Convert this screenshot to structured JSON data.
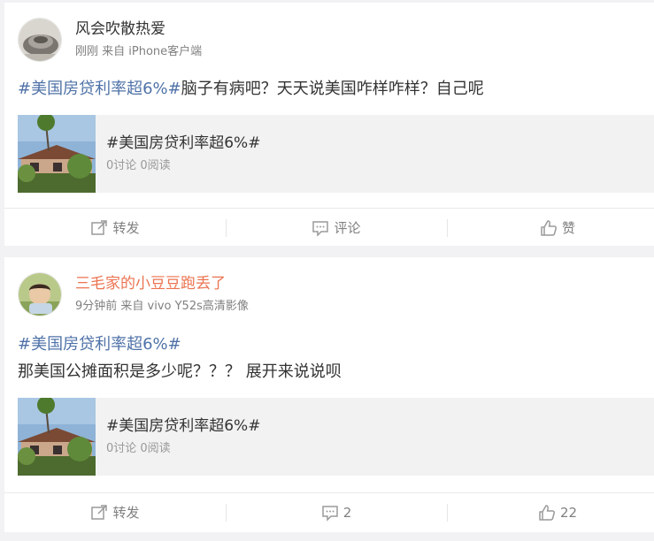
{
  "posts": [
    {
      "username": "风会吹散热爱",
      "meta": "刚刚 来自 iPhone客户端",
      "hashtag": "#美国房贷利率超6%#",
      "text": "脑子有病吧？天天说美国咋样咋样？自己呢",
      "topic": {
        "title": "#美国房贷利率超6%#",
        "stats": "0讨论 0阅读"
      },
      "actions": {
        "repost": "转发",
        "comment": "评论",
        "like": "赞"
      }
    },
    {
      "username": "三毛家的小豆豆跑丢了",
      "meta": "9分钟前 来自 vivo Y52s高清影像",
      "hashtag": "#美国房贷利率超6%#",
      "text": "那美国公摊面积是多少呢？？？ 展开来说说呗",
      "topic": {
        "title": "#美国房贷利率超6%#",
        "stats": "0讨论 0阅读"
      },
      "actions": {
        "repost": "转发",
        "comment": "2",
        "like": "22"
      }
    }
  ],
  "colors": {
    "hashtag": "#4f72a8",
    "orange_username": "#eb7350",
    "meta": "#808080",
    "background": "#f2f2f5"
  },
  "icons": [
    "avatar-image",
    "topic-thumbnail",
    "repost-icon",
    "comment-icon",
    "like-icon"
  ]
}
